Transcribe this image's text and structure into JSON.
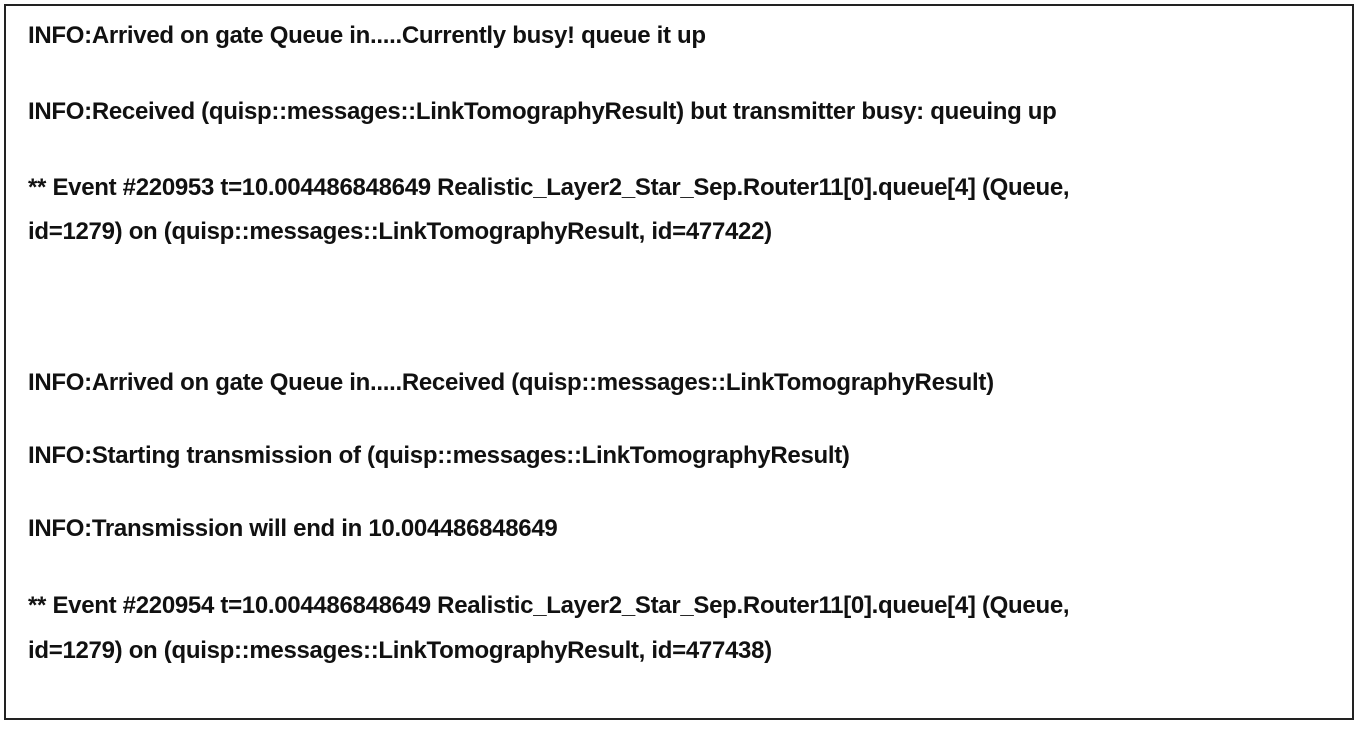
{
  "log": {
    "lines": [
      "INFO:Arrived on gate Queue in.....Currently busy! queue it up",
      "INFO:Received (quisp::messages::LinkTomographyResult) but transmitter busy: queuing up",
      "** Event #220953  t=10.004486848649   Realistic_Layer2_Star_Sep.Router11[0].queue[4] (Queue,",
      "id=1279)  on  (quisp::messages::LinkTomographyResult, id=477422)",
      "INFO:Arrived on gate Queue in.....Received (quisp::messages::LinkTomographyResult)",
      "INFO:Starting transmission of (quisp::messages::LinkTomographyResult)",
      "INFO:Transmission will end in 10.004486848649",
      "** Event #220954  t=10.004486848649   Realistic_Layer2_Star_Sep.Router11[0].queue[4] (Queue,",
      "id=1279)  on  (quisp::messages::LinkTomographyResult, id=477438)"
    ]
  }
}
